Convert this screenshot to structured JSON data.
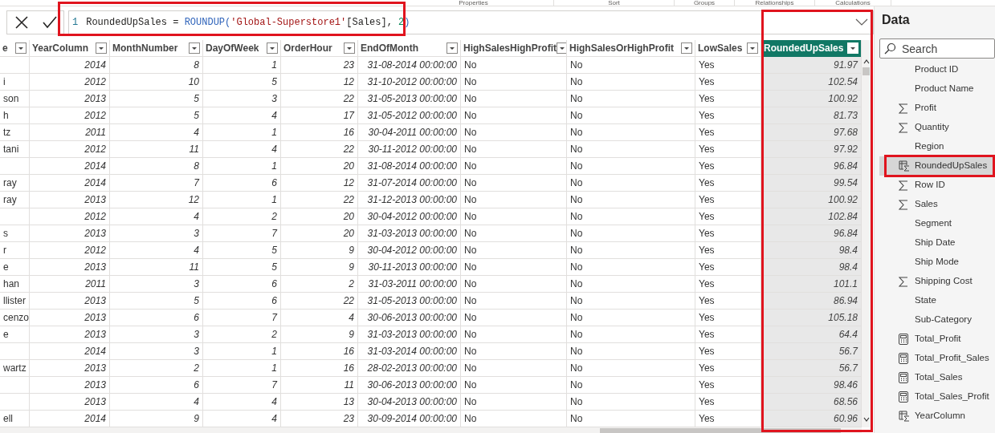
{
  "ribbon_groups": [
    "Properties",
    "Sort",
    "Groups",
    "Relationships",
    "Calculations"
  ],
  "formula_bar": {
    "line_number": "1",
    "highlighted": true,
    "tokens": [
      {
        "kind": "plain",
        "text": "RoundedUpSales = "
      },
      {
        "kind": "function",
        "text": "ROUNDUP("
      },
      {
        "kind": "string",
        "text": "'Global-Superstore1'"
      },
      {
        "kind": "plain",
        "text": "[Sales], "
      },
      {
        "kind": "number",
        "text": "2"
      },
      {
        "kind": "function",
        "text": ")"
      }
    ]
  },
  "table": {
    "columns": [
      {
        "label": "e",
        "kind": "text",
        "selected": false,
        "highlighted": false
      },
      {
        "label": "YearColumn",
        "kind": "number",
        "selected": false,
        "highlighted": false
      },
      {
        "label": "MonthNumber",
        "kind": "number",
        "selected": false,
        "highlighted": false
      },
      {
        "label": "DayOfWeek",
        "kind": "number",
        "selected": false,
        "highlighted": false
      },
      {
        "label": "OrderHour",
        "kind": "number",
        "selected": false,
        "highlighted": false
      },
      {
        "label": "EndOfMonth",
        "kind": "number",
        "selected": false,
        "highlighted": false
      },
      {
        "label": "HighSalesHighProfit",
        "kind": "text",
        "selected": false,
        "highlighted": false
      },
      {
        "label": "HighSalesOrHighProfit",
        "kind": "text",
        "selected": false,
        "highlighted": false
      },
      {
        "label": "LowSales",
        "kind": "text",
        "selected": false,
        "highlighted": false
      },
      {
        "label": "RoundedUpSales",
        "kind": "number",
        "selected": true,
        "highlighted": true
      }
    ],
    "rows": [
      [
        null,
        "2014",
        "8",
        "1",
        "23",
        "31-08-2014 00:00:00",
        "No",
        "No",
        "Yes",
        "91.97"
      ],
      [
        "i",
        "2012",
        "10",
        "5",
        "12",
        "31-10-2012 00:00:00",
        "No",
        "No",
        "Yes",
        "102.54"
      ],
      [
        "son",
        "2013",
        "5",
        "3",
        "22",
        "31-05-2013 00:00:00",
        "No",
        "No",
        "Yes",
        "100.92"
      ],
      [
        "h",
        "2012",
        "5",
        "4",
        "17",
        "31-05-2012 00:00:00",
        "No",
        "No",
        "Yes",
        "81.73"
      ],
      [
        "tz",
        "2011",
        "4",
        "1",
        "16",
        "30-04-2011 00:00:00",
        "No",
        "No",
        "Yes",
        "97.68"
      ],
      [
        "tani",
        "2012",
        "11",
        "4",
        "22",
        "30-11-2012 00:00:00",
        "No",
        "No",
        "Yes",
        "97.92"
      ],
      [
        null,
        "2014",
        "8",
        "1",
        "20",
        "31-08-2014 00:00:00",
        "No",
        "No",
        "Yes",
        "96.84"
      ],
      [
        "ray",
        "2014",
        "7",
        "6",
        "12",
        "31-07-2014 00:00:00",
        "No",
        "No",
        "Yes",
        "99.54"
      ],
      [
        "ray",
        "2013",
        "12",
        "1",
        "22",
        "31-12-2013 00:00:00",
        "No",
        "No",
        "Yes",
        "100.92"
      ],
      [
        null,
        "2012",
        "4",
        "2",
        "20",
        "30-04-2012 00:00:00",
        "No",
        "No",
        "Yes",
        "102.84"
      ],
      [
        "s",
        "2013",
        "3",
        "7",
        "20",
        "31-03-2013 00:00:00",
        "No",
        "No",
        "Yes",
        "96.84"
      ],
      [
        "r",
        "2012",
        "4",
        "5",
        "9",
        "30-04-2012 00:00:00",
        "No",
        "No",
        "Yes",
        "98.4"
      ],
      [
        "e",
        "2013",
        "11",
        "5",
        "9",
        "30-11-2013 00:00:00",
        "No",
        "No",
        "Yes",
        "98.4"
      ],
      [
        "han",
        "2011",
        "3",
        "6",
        "2",
        "31-03-2011 00:00:00",
        "No",
        "No",
        "Yes",
        "101.1"
      ],
      [
        "llister",
        "2013",
        "5",
        "6",
        "22",
        "31-05-2013 00:00:00",
        "No",
        "No",
        "Yes",
        "86.94"
      ],
      [
        "cenzo",
        "2013",
        "6",
        "7",
        "4",
        "30-06-2013 00:00:00",
        "No",
        "No",
        "Yes",
        "105.18"
      ],
      [
        "e",
        "2013",
        "3",
        "2",
        "9",
        "31-03-2013 00:00:00",
        "No",
        "No",
        "Yes",
        "64.4"
      ],
      [
        null,
        "2014",
        "3",
        "1",
        "16",
        "31-03-2014 00:00:00",
        "No",
        "No",
        "Yes",
        "56.7"
      ],
      [
        "wartz",
        "2013",
        "2",
        "1",
        "16",
        "28-02-2013 00:00:00",
        "No",
        "No",
        "Yes",
        "56.7"
      ],
      [
        null,
        "2013",
        "6",
        "7",
        "11",
        "30-06-2013 00:00:00",
        "No",
        "No",
        "Yes",
        "98.46"
      ],
      [
        null,
        "2013",
        "4",
        "4",
        "13",
        "30-04-2013 00:00:00",
        "No",
        "No",
        "Yes",
        "68.56"
      ],
      [
        "ell",
        "2014",
        "9",
        "4",
        "23",
        "30-09-2014 00:00:00",
        "No",
        "No",
        "Yes",
        "60.96"
      ]
    ]
  },
  "data_pane": {
    "title": "Data",
    "search": {
      "placeholder": "Search"
    },
    "fields": [
      {
        "label": "Product ID",
        "kind": "plain",
        "selected": false,
        "highlighted": false
      },
      {
        "label": "Product Name",
        "kind": "plain",
        "selected": false,
        "highlighted": false
      },
      {
        "label": "Profit",
        "kind": "sum",
        "selected": false,
        "highlighted": false
      },
      {
        "label": "Quantity",
        "kind": "sum",
        "selected": false,
        "highlighted": false
      },
      {
        "label": "Region",
        "kind": "plain",
        "selected": false,
        "highlighted": false
      },
      {
        "label": "RoundedUpSales",
        "kind": "calculated",
        "selected": true,
        "highlighted": true
      },
      {
        "label": "Row ID",
        "kind": "sum",
        "selected": false,
        "highlighted": false
      },
      {
        "label": "Sales",
        "kind": "sum",
        "selected": false,
        "highlighted": false
      },
      {
        "label": "Segment",
        "kind": "plain",
        "selected": false,
        "highlighted": false
      },
      {
        "label": "Ship Date",
        "kind": "plain",
        "selected": false,
        "highlighted": false
      },
      {
        "label": "Ship Mode",
        "kind": "plain",
        "selected": false,
        "highlighted": false
      },
      {
        "label": "Shipping Cost",
        "kind": "sum",
        "selected": false,
        "highlighted": false
      },
      {
        "label": "State",
        "kind": "plain",
        "selected": false,
        "highlighted": false
      },
      {
        "label": "Sub-Category",
        "kind": "plain",
        "selected": false,
        "highlighted": false
      },
      {
        "label": "Total_Profit",
        "kind": "measure",
        "selected": false,
        "highlighted": false
      },
      {
        "label": "Total_Profit_Sales",
        "kind": "measure",
        "selected": false,
        "highlighted": false
      },
      {
        "label": "Total_Sales",
        "kind": "measure",
        "selected": false,
        "highlighted": false
      },
      {
        "label": "Total_Sales_Profit",
        "kind": "measure",
        "selected": false,
        "highlighted": false
      },
      {
        "label": "YearColumn",
        "kind": "calculated",
        "selected": false,
        "highlighted": false
      }
    ]
  }
}
